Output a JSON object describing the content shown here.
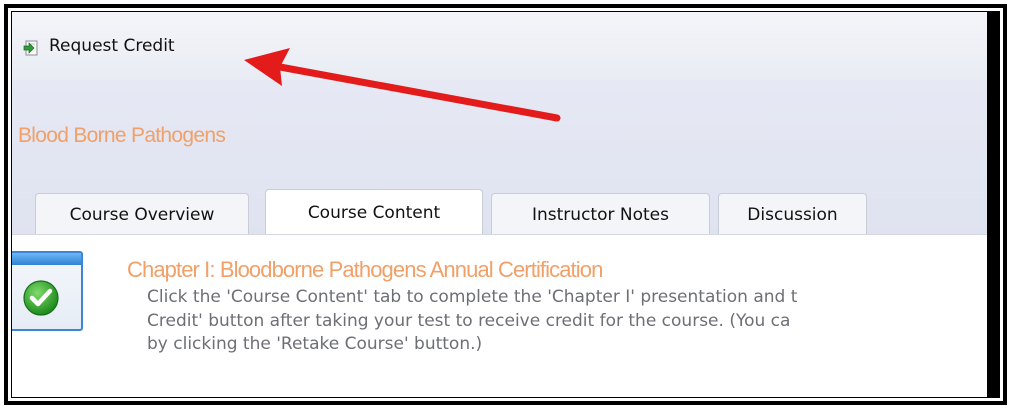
{
  "toolbar": {
    "request_credit_label": "Request Credit",
    "request_credit_icon": "document-arrow-icon"
  },
  "course": {
    "title": "Blood Borne Pathogens"
  },
  "tabs": [
    {
      "label": "Course Overview",
      "active": false
    },
    {
      "label": "Course Content",
      "active": true
    },
    {
      "label": "Instructor Notes",
      "active": false
    },
    {
      "label": "Discussion",
      "active": false
    }
  ],
  "chapter": {
    "title": "Chapter I: Bloodborne Pathogens Annual Certification",
    "description_lines": [
      "Click the 'Course Content' tab to complete the 'Chapter I' presentation and t",
      "Credit' button after taking your test to receive credit for the course. (You ca",
      "by clicking the 'Retake Course' button.)"
    ],
    "status_icon": "green-checkmark-icon"
  },
  "colors": {
    "accent": "#f0a068",
    "arrow": "#e31b1b",
    "tab_border": "#c9cdd8",
    "icon_blue": "#3b86d6"
  }
}
